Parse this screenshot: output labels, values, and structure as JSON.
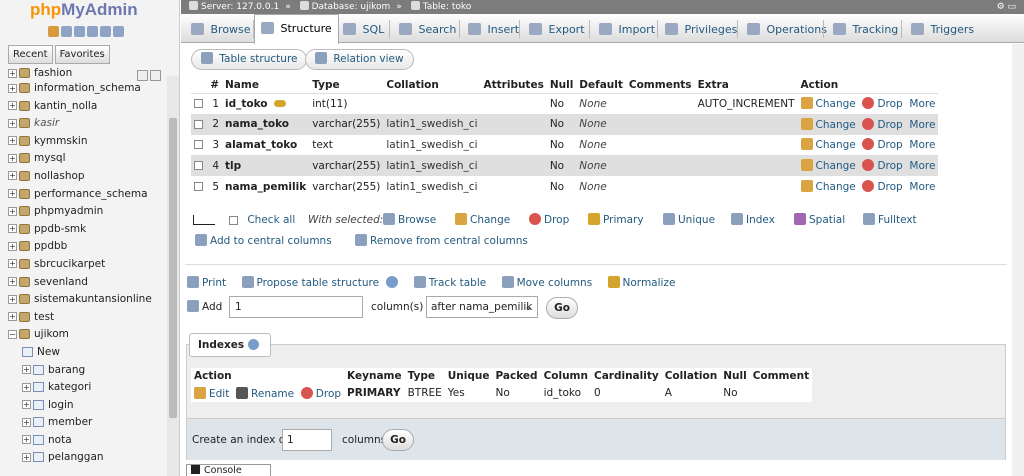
{
  "sidebar": {
    "logo": {
      "php": "php",
      "myadmin": "MyAdmin"
    },
    "recent_label": "Recent",
    "favorites_label": "Favorites",
    "databases": [
      {
        "name": "fashion"
      },
      {
        "name": "information_schema"
      },
      {
        "name": "kantin_nolla"
      },
      {
        "name": "kasir"
      },
      {
        "name": "kymmskin"
      },
      {
        "name": "mysql"
      },
      {
        "name": "nollashop"
      },
      {
        "name": "performance_schema"
      },
      {
        "name": "phpmyadmin"
      },
      {
        "name": "ppdb-smk"
      },
      {
        "name": "ppdbb"
      },
      {
        "name": "sbrcucikarpet"
      },
      {
        "name": "sevenland"
      },
      {
        "name": "sistemakuntansionline"
      },
      {
        "name": "test"
      },
      {
        "name": "ujikom"
      }
    ],
    "ujikom_children": {
      "new_label": "New",
      "tables": [
        "barang",
        "kategori",
        "login",
        "member",
        "nota",
        "pelanggan"
      ]
    }
  },
  "breadcrumb": {
    "server": "Server: 127.0.0.1",
    "database": "Database: ujikom",
    "table": "Table: toko"
  },
  "tabs": [
    "Browse",
    "Structure",
    "SQL",
    "Search",
    "Insert",
    "Export",
    "Import",
    "Privileges",
    "Operations",
    "Tracking",
    "Triggers"
  ],
  "subtabs": {
    "table_structure": "Table structure",
    "relation_view": "Relation view"
  },
  "structure": {
    "headers": [
      "#",
      "Name",
      "Type",
      "Collation",
      "Attributes",
      "Null",
      "Default",
      "Comments",
      "Extra",
      "Action"
    ],
    "action_labels": {
      "change": "Change",
      "drop": "Drop",
      "more": "More"
    },
    "rows": [
      {
        "num": "1",
        "name": "id_toko",
        "type": "int(11)",
        "collation": "",
        "attributes": "",
        "null": "No",
        "default": "None",
        "comments": "",
        "extra": "AUTO_INCREMENT"
      },
      {
        "num": "2",
        "name": "nama_toko",
        "type": "varchar(255)",
        "collation": "latin1_swedish_ci",
        "attributes": "",
        "null": "No",
        "default": "None",
        "comments": "",
        "extra": ""
      },
      {
        "num": "3",
        "name": "alamat_toko",
        "type": "text",
        "collation": "latin1_swedish_ci",
        "attributes": "",
        "null": "No",
        "default": "None",
        "comments": "",
        "extra": ""
      },
      {
        "num": "4",
        "name": "tlp",
        "type": "varchar(255)",
        "collation": "latin1_swedish_ci",
        "attributes": "",
        "null": "No",
        "default": "None",
        "comments": "",
        "extra": ""
      },
      {
        "num": "5",
        "name": "nama_pemilik",
        "type": "varchar(255)",
        "collation": "latin1_swedish_ci",
        "attributes": "",
        "null": "No",
        "default": "None",
        "comments": "",
        "extra": ""
      }
    ]
  },
  "with_selected": {
    "check_all": "Check all",
    "label": "With selected:",
    "actions": [
      "Browse",
      "Change",
      "Drop",
      "Primary",
      "Unique",
      "Index",
      "Spatial",
      "Fulltext"
    ],
    "add_central": "Add to central columns",
    "remove_central": "Remove from central columns"
  },
  "tools": {
    "print": "Print",
    "propose": "Propose table structure",
    "track": "Track table",
    "move": "Move columns",
    "normalize": "Normalize"
  },
  "add_columns": {
    "label": "Add",
    "value": "1",
    "unit": "column(s)",
    "position": "after nama_pemilik",
    "go": "Go"
  },
  "indexes": {
    "title": "Indexes",
    "headers": [
      "Action",
      "Keyname",
      "Type",
      "Unique",
      "Packed",
      "Column",
      "Cardinality",
      "Collation",
      "Null",
      "Comment"
    ],
    "action_labels": {
      "edit": "Edit",
      "rename": "Rename",
      "drop": "Drop"
    },
    "rows": [
      {
        "keyname": "PRIMARY",
        "type": "BTREE",
        "unique": "Yes",
        "packed": "No",
        "column": "id_toko",
        "cardinality": "0",
        "collation": "A",
        "null": "No",
        "comment": ""
      }
    ],
    "create_label": "Create an index on",
    "create_value": "1",
    "create_unit": "columns",
    "go": "Go"
  },
  "console_label": "Console",
  "colors": {
    "accent": "#235a81",
    "logo_orange": "#f89406",
    "logo_blue": "#6c78af",
    "drop_red": "#d9534f"
  }
}
